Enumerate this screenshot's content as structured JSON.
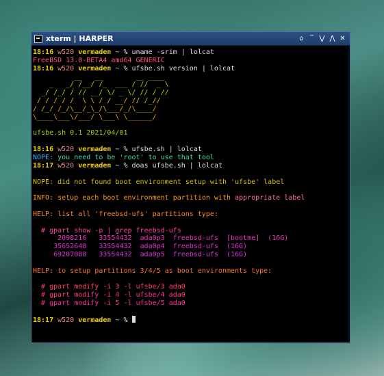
{
  "window": {
    "title": "xterm | HARPER",
    "buttons": [
      "⌂",
      "‾",
      "⋁",
      "⋀",
      "✕"
    ]
  },
  "colors": {
    "background": "#000000",
    "titlebar": "#2d4f83",
    "prompt_time": "#f0d000",
    "prompt_host": "#e08a8a",
    "prompt_user": "#f0d000"
  },
  "lines": [
    {
      "segs": [
        {
          "t": "18:16 ",
          "c": "#f0d000",
          "b": true
        },
        {
          "t": "w520 ",
          "c": "#e08a8a"
        },
        {
          "t": "vermaden",
          "c": "#f0d000",
          "b": true
        },
        {
          "t": " ~ % uname -srim | lolcat",
          "c": "#dddddd"
        }
      ]
    },
    {
      "segs": [
        {
          "t": "FreeBSD 13.0-BETA4 amd64 GENERIC",
          "c": "#ff4f7a"
        }
      ]
    },
    {
      "segs": [
        {
          "t": "18:16 ",
          "c": "#f0d000",
          "b": true
        },
        {
          "t": "w520 ",
          "c": "#e08a8a"
        },
        {
          "t": "vermaden",
          "c": "#f0d000",
          "b": true
        },
        {
          "t": " ~ % ufsbe.sh version | lolcat",
          "c": "#dddddd"
        }
      ]
    },
    {
      "segs": [
        {
          "t": "          __   __        __ ____",
          "c": "#9ad400"
        }
      ]
    },
    {
      "segs": [
        {
          "t": "    _   _/ /__/ /_  ___ / //  _ \\",
          "c": "#b8d000"
        }
      ]
    },
    {
      "segs": [
        {
          "t": "  _/ /_/ / // __/ \\/ _ \\/ // / //",
          "c": "#c8cc00"
        }
      ]
    },
    {
      "segs": [
        {
          "t": " / / / / /  \\ \\ / / __/ // /_//",
          "c": "#d8c400"
        }
      ]
    },
    {
      "segs": [
        {
          "t": "/ /_/ /_/\\__/_\\_/\\___/_/\\____/ ",
          "c": "#e0b400"
        }
      ]
    },
    {
      "segs": [
        {
          "t": "\\____\\___\\/___/ \\___\\ \\______/",
          "c": "#e8a000"
        }
      ]
    },
    {
      "segs": [
        {
          "t": "",
          "c": "#dddddd"
        }
      ]
    },
    {
      "segs": [
        {
          "t": "ufsbe.sh 0.1 2021/04/01",
          "c": "#a8d000"
        }
      ]
    },
    {
      "segs": [
        {
          "t": "",
          "c": "#dddddd"
        }
      ]
    },
    {
      "segs": [
        {
          "t": "18:16 ",
          "c": "#f0d000",
          "b": true
        },
        {
          "t": "w520 ",
          "c": "#e08a8a"
        },
        {
          "t": "vermaden",
          "c": "#f0d000",
          "b": true
        },
        {
          "t": " ~ % ufsbe.sh | lolcat",
          "c": "#dddddd"
        }
      ]
    },
    {
      "segs": [
        {
          "t": "NOPE: ",
          "c": "#3cb8ff"
        },
        {
          "t": "you need to be 'root' to use that tool",
          "c": "#40d8b8"
        }
      ]
    },
    {
      "segs": [
        {
          "t": "18:17 ",
          "c": "#f0d000",
          "b": true
        },
        {
          "t": "w520 ",
          "c": "#e08a8a"
        },
        {
          "t": "vermaden",
          "c": "#f0d000",
          "b": true
        },
        {
          "t": " ~ % doas ufsbe.sh | lolcat",
          "c": "#dddddd"
        }
      ]
    },
    {
      "segs": [
        {
          "t": "",
          "c": "#dddddd"
        }
      ]
    },
    {
      "segs": [
        {
          "t": "NOPE: did not found boot environment setup with 'ufsbe' label",
          "c": "#d8c000"
        }
      ]
    },
    {
      "segs": [
        {
          "t": "",
          "c": "#dddddd"
        }
      ]
    },
    {
      "segs": [
        {
          "t": "INFO: setup each boot environment partition with ",
          "c": "#ff9a10"
        },
        {
          "t": "appropriate label",
          "c": "#ff6cb0"
        }
      ]
    },
    {
      "segs": [
        {
          "t": "",
          "c": "#dddddd"
        }
      ]
    },
    {
      "segs": [
        {
          "t": "HELP: list all 'freebsd-ufs' partitions type:",
          "c": "#ff8a30"
        }
      ]
    },
    {
      "segs": [
        {
          "t": "",
          "c": "#dddddd"
        }
      ]
    },
    {
      "segs": [
        {
          "t": "  # gpart show -p | grep freebsd-ufs",
          "c": "#ff40a8"
        }
      ]
    },
    {
      "segs": [
        {
          "t": "      2098216   33554432  ada0p3  freebsd-ufs  [bootme]  (16G)",
          "c": "#f030c0"
        }
      ]
    },
    {
      "segs": [
        {
          "t": "     35652648   33554432  ada0p4  freebsd-ufs  (16G)",
          "c": "#e030d0"
        }
      ]
    },
    {
      "segs": [
        {
          "t": "     69207080   33554432  ada0p5  freebsd-ufs  (16G)",
          "c": "#d838d8"
        }
      ]
    },
    {
      "segs": [
        {
          "t": "",
          "c": "#dddddd"
        }
      ]
    },
    {
      "segs": [
        {
          "t": "HELP: to setup partitions 3/4/5 as boot environments type:",
          "c": "#ff7030"
        }
      ]
    },
    {
      "segs": [
        {
          "t": "",
          "c": "#dddddd"
        }
      ]
    },
    {
      "segs": [
        {
          "t": "  # gpart modify -i 3 -l ufsbe/3 ada0",
          "c": "#ff4068"
        }
      ]
    },
    {
      "segs": [
        {
          "t": "  # gpart modify -i 4 -l ufsbe/4 ada0",
          "c": "#ff3880"
        }
      ]
    },
    {
      "segs": [
        {
          "t": "  # gpart modify -i 5 -l ufsbe/5 ada0",
          "c": "#ff3098"
        }
      ]
    },
    {
      "segs": [
        {
          "t": "",
          "c": "#dddddd"
        }
      ]
    },
    {
      "segs": [
        {
          "t": "18:17 ",
          "c": "#f0d000",
          "b": true
        },
        {
          "t": "w520 ",
          "c": "#e08a8a"
        },
        {
          "t": "vermaden",
          "c": "#f0d000",
          "b": true
        },
        {
          "t": " ~ % ",
          "c": "#dddddd"
        }
      ]
    }
  ]
}
